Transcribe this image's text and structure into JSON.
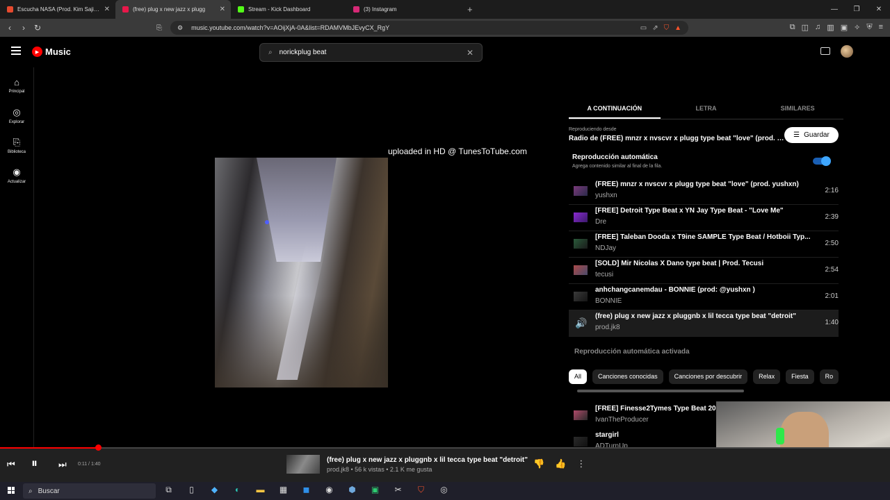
{
  "browser": {
    "tabs": [
      {
        "label": "Escucha NASA (Prod. Kim Sajiro) de :",
        "color": "#e64a2e"
      },
      {
        "label": "(free) plug x new jazz x plugg",
        "color": "#e8184a"
      },
      {
        "label": "Stream - Kick Dashboard",
        "color": "#53fc18"
      },
      {
        "label": "(3) Instagram",
        "color": "#d62976"
      }
    ],
    "new_tab": "+",
    "url": "music.youtube.com/watch?v=AOijXjA-0A&list=RDAMVMbJEvyCX_RgY"
  },
  "header": {
    "logo": "Music",
    "search_value": "norickplug beat"
  },
  "sidebar": {
    "items": [
      {
        "label": "Principal",
        "icon": "⌂"
      },
      {
        "label": "Explorar",
        "icon": "◎"
      },
      {
        "label": "Biblioteca",
        "icon": "⎘"
      },
      {
        "label": "Actualizar",
        "icon": "◉"
      }
    ]
  },
  "video": {
    "overlay_text": "uploaded in HD @ TunesToTube.com"
  },
  "panel": {
    "tabs": [
      "A CONTINUACIÓN",
      "LETRA",
      "SIMILARES"
    ],
    "playing_from": "Reproduciendo desde",
    "radio_title": "Radio de (FREE) mnzr x nvscvr x plugg type beat \"love\" (prod. y...",
    "save_label": "Guardar",
    "autoplay_title": "Reproducción automática",
    "autoplay_subtitle": "Agrega contenido similar al final de la fila.",
    "queue": [
      {
        "title": "(FREE) mnzr x nvscvr x plugg type beat \"love\" (prod. yushxn)",
        "artist": "yushxn",
        "duration": "2:16"
      },
      {
        "title": "[FREE] Detroit Type Beat x YN Jay Type Beat - \"Love Me\"",
        "artist": "Dre",
        "duration": "2:39"
      },
      {
        "title": "[FREE] Taleban Dooda x T9ine SAMPLE Type Beat / Hotboii Typ...",
        "artist": "NDJay",
        "duration": "2:50"
      },
      {
        "title": "[SOLD] Mir Nicolas X Dano type beat | Prod. Tecusi",
        "artist": "tecusi",
        "duration": "2:54"
      },
      {
        "title": "anhchangcanemdau - BONNIE (prod: @yushxn )",
        "artist": "BONNIE",
        "duration": "2:01"
      },
      {
        "title": "(free) plug x new jazz x pluggnb x lil tecca type beat \"detroit\"",
        "artist": "prod.jk8",
        "duration": "1:40"
      }
    ],
    "autoplay_on": "Reproducción automática activada",
    "chips": [
      "All",
      "Canciones conocidas",
      "Canciones por descubrir",
      "Relax",
      "Fiesta",
      "Ro"
    ],
    "autoplay_list": [
      {
        "title": "[FREE] Finesse2Tymes Type Beat 20",
        "artist": "IvanTheProducer"
      },
      {
        "title": "stargirl",
        "artist": "ADTurnUp"
      }
    ]
  },
  "player": {
    "time": "0:11 / 1:40",
    "progress": 0.11,
    "title": "(free) plug x new jazz x pluggnb x lil tecca type beat \"detroit\"",
    "meta": "prod.jk8 • 56 k vistas • 2.1 K me gusta"
  },
  "taskbar": {
    "search_label": "Buscar"
  }
}
